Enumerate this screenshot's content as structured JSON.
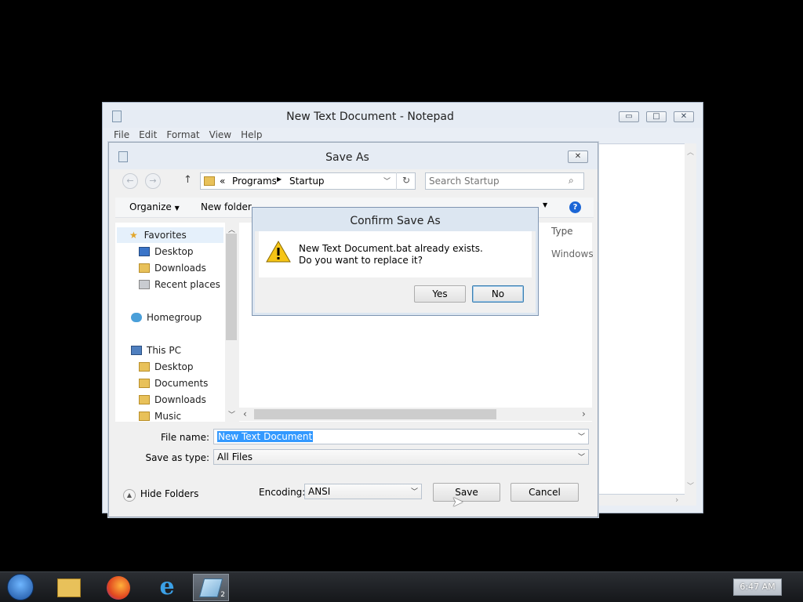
{
  "notepad": {
    "title": "New Text Document - Notepad",
    "menu": [
      "File",
      "Edit",
      "Format",
      "View",
      "Help"
    ],
    "controls": {
      "minimize": "▭",
      "maximize": "□",
      "close": "✕"
    }
  },
  "save_as": {
    "title": "Save As",
    "close": "✕",
    "nav": {
      "back": "←",
      "forward": "→",
      "up": "↑"
    },
    "breadcrumb": {
      "prefix": "«",
      "parts": [
        "Programs",
        "Startup"
      ]
    },
    "search_placeholder": "Search Startup",
    "toolbar": {
      "organize": "Organize",
      "new_folder": "New folder"
    },
    "nav_pane": {
      "favorites": "Favorites",
      "favorites_items": [
        "Desktop",
        "Downloads",
        "Recent places"
      ],
      "homegroup": "Homegroup",
      "this_pc": "This PC",
      "pc_items": [
        "Desktop",
        "Documents",
        "Downloads",
        "Music"
      ]
    },
    "columns": {
      "type": "Type"
    },
    "file_row": {
      "type": "Windows"
    },
    "file_name_label": "File name:",
    "file_name_value": "New Text Document",
    "save_as_type_label": "Save as type:",
    "save_as_type_value": "All Files",
    "hide_folders": "Hide Folders",
    "encoding_label": "Encoding:",
    "encoding_value": "ANSI",
    "save_button": "Save",
    "cancel_button": "Cancel"
  },
  "confirm": {
    "title": "Confirm Save As",
    "line1": "New Text Document.bat already exists.",
    "line2": "Do you want to replace it?",
    "yes": "Yes",
    "no": "No"
  },
  "taskbar": {
    "clock": "6:47 AM",
    "notepad_badge": "2"
  },
  "colors": {
    "selection": "#3399ff",
    "accent": "#1c66d6"
  }
}
